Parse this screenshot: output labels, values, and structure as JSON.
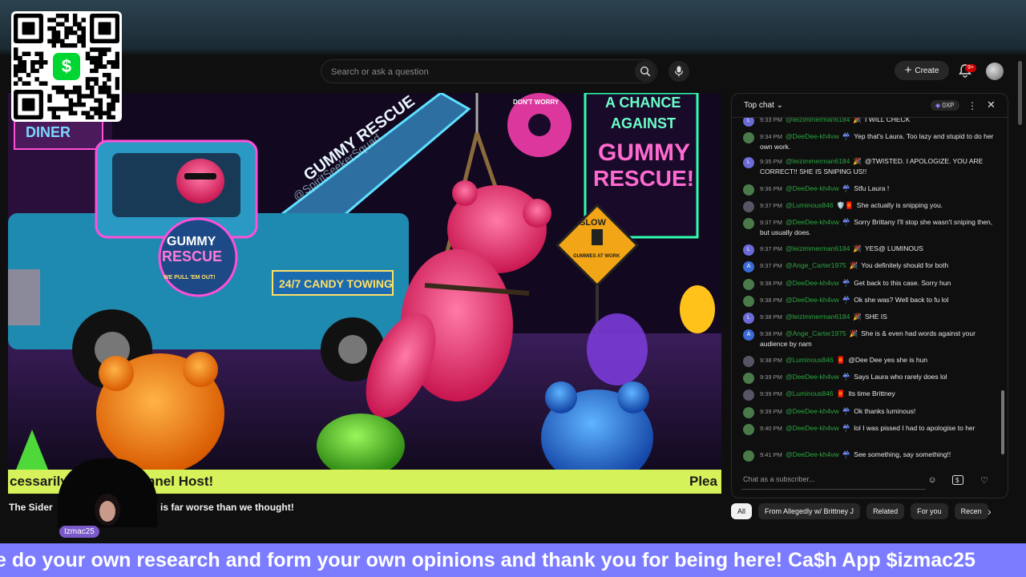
{
  "search": {
    "placeholder": "Search or ask a question"
  },
  "header": {
    "create_label": "Create",
    "notif_badge": "9+"
  },
  "qr": {
    "brand_symbol": "$"
  },
  "video": {
    "overlay_text": "cessarily      f the channel Host!",
    "overlay_right": "Plea",
    "scene_texts": {
      "diner": "DINER",
      "gummy_rescue_boom": "GUMMY RESCUE",
      "watermark": "@SpiritSeekerSquad",
      "door_logo_top": "GUMMY",
      "door_logo_mid": "RESCUE",
      "door_logo_bottom": "WE PULL 'EM OUT!",
      "truck_side": "24/7 CANDY TOWING",
      "billboard_line1": "A CHANCE",
      "billboard_line2": "AGAINST",
      "billboard_line3": "GUMMY",
      "billboard_line4": "RESCUE!",
      "donut": "DON'T WORRY",
      "sign_top": "SLOW",
      "sign_bottom": "GUMMIES AT WORK"
    }
  },
  "video_title": {
    "left": "The Sider",
    "right": "ors is far worse than we thought!"
  },
  "cam": {
    "label": "Izmac25"
  },
  "chat": {
    "title": "Top chat",
    "xp": "0XP",
    "messages": [
      {
        "initial": "L",
        "color": "#6b6bd6",
        "time": "9:33 PM",
        "author": "@leizimmerman6184",
        "badge": "🎉",
        "text": "I WILL CHECK"
      },
      {
        "initial": "",
        "color": "#4a7a4a",
        "time": "9:34 PM",
        "author": "@DeeDee-kh4vw",
        "badge": "☔",
        "text": "Yep that's Laura. Too lazy and stupid to do her own work."
      },
      {
        "initial": "L",
        "color": "#6b6bd6",
        "time": "9:35 PM",
        "author": "@leizimmerman6184",
        "badge": "🎉",
        "text": "@TWISTED. I APOLOGIZE. YOU ARE CORRECT!! SHE IS SNIPING US!!"
      },
      {
        "initial": "",
        "color": "#4a7a4a",
        "time": "9:36 PM",
        "author": "@DeeDee-kh4vw",
        "badge": "☔",
        "text": "Stfu Laura !"
      },
      {
        "initial": "",
        "color": "#555566",
        "time": "9:37 PM",
        "author": "@Luminous846",
        "badge": "🛡️🧧",
        "text": "She actually is snipping you."
      },
      {
        "initial": "",
        "color": "#4a7a4a",
        "time": "9:37 PM",
        "author": "@DeeDee-kh4vw",
        "badge": "☔",
        "text": "Sorry Brittany I'll stop she wasn't sniping then, but usually does."
      },
      {
        "initial": "L",
        "color": "#6b6bd6",
        "time": "9:37 PM",
        "author": "@leizimmerman6184",
        "badge": "🎉",
        "text": "YES@ LUMINOUS"
      },
      {
        "initial": "A",
        "color": "#3a6ad6",
        "time": "9:37 PM",
        "author": "@Ange_Carter1975",
        "badge": "🎉",
        "text": "You definitely should for both"
      },
      {
        "initial": "",
        "color": "#4a7a4a",
        "time": "9:38 PM",
        "author": "@DeeDee-kh4vw",
        "badge": "☔",
        "text": "Get back to this case. Sorry hun"
      },
      {
        "initial": "",
        "color": "#4a7a4a",
        "time": "9:38 PM",
        "author": "@DeeDee-kh4vw",
        "badge": "☔",
        "text": "Ok she was? Well back to fu lol"
      },
      {
        "initial": "L",
        "color": "#6b6bd6",
        "time": "9:38 PM",
        "author": "@leizimmerman6184",
        "badge": "🎉",
        "text": "SHE IS"
      },
      {
        "initial": "A",
        "color": "#3a6ad6",
        "time": "9:38 PM",
        "author": "@Ange_Carter1975",
        "badge": "🎉",
        "text": "She is & even had words against your audience by nam"
      },
      {
        "initial": "",
        "color": "#555566",
        "time": "9:38 PM",
        "author": "@Luminous846",
        "badge": "🧧",
        "text": "@Dee Dee yes she is hun"
      },
      {
        "initial": "",
        "color": "#4a7a4a",
        "time": "9:39 PM",
        "author": "@DeeDee-kh4vw",
        "badge": "☔",
        "text": "Says Laura who rarely does lol"
      },
      {
        "initial": "",
        "color": "#555566",
        "time": "9:39 PM",
        "author": "@Luminous846",
        "badge": "🧧",
        "text": "Its time Brittney"
      },
      {
        "initial": "",
        "color": "#4a7a4a",
        "time": "9:39 PM",
        "author": "@DeeDee-kh4vw",
        "badge": "☔",
        "text": "Ok thanks luminous!"
      },
      {
        "initial": "",
        "color": "#4a7a4a",
        "time": "9:40 PM",
        "author": "@DeeDee-kh4vw",
        "badge": "☔",
        "text": "lol I was pissed I had to apologise to her"
      },
      {
        "initial": "",
        "color": "#4a7a4a",
        "time": "9:41 PM",
        "author": "@DeeDee-kh4vw",
        "badge": "☔",
        "text": "See something, say something!!"
      }
    ],
    "input_placeholder": "Chat as a subscriber..."
  },
  "chips": [
    "All",
    "From Allegedly w/ Brittney J",
    "Related",
    "For you",
    "Recen"
  ],
  "marquee": "e do your own research and form your own opinions and thank you for being here! Ca$h App $izmac25",
  "colors": {
    "accent_green": "#2ba640",
    "marquee_bg": "#7b7cff",
    "overlay_strip": "#d6f25a"
  }
}
